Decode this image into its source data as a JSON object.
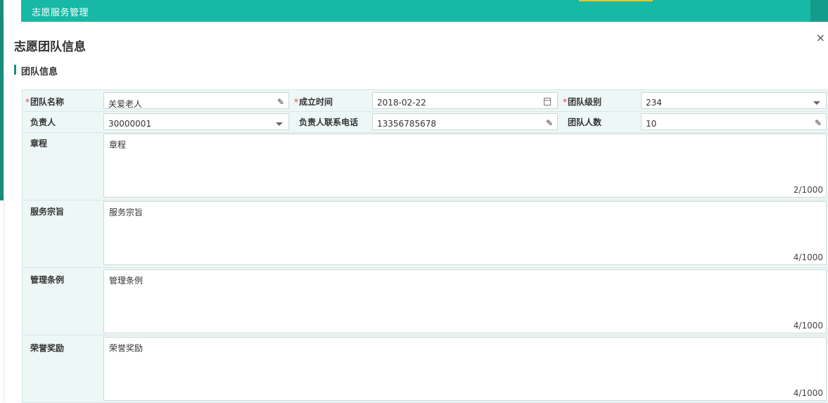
{
  "app": {
    "title": "志愿服务管理",
    "accent_color": "#17b9a6",
    "highlight_color": "#f4c21b"
  },
  "modal": {
    "title": "志愿团队信息",
    "close_icon": "close-icon",
    "section_title": "团队信息"
  },
  "form": {
    "team_name": {
      "label": "团队名称",
      "required": "*",
      "value": "关爱老人",
      "icon": "edit-icon"
    },
    "founded_date": {
      "label": "成立时间",
      "required": "*",
      "value": "2018-02-22",
      "icon": "calendar-icon"
    },
    "team_level": {
      "label": "团队级别",
      "required": "*",
      "value": "234",
      "icon": "dropdown-icon"
    },
    "leader": {
      "label": "负责人",
      "value": "30000001",
      "icon": "dropdown-icon"
    },
    "leader_phone": {
      "label": "负责人联系电话",
      "value": "13356785678",
      "icon": "edit-icon"
    },
    "member_count": {
      "label": "团队人数",
      "value": "10",
      "icon": "edit-icon"
    },
    "charter": {
      "label": "章程",
      "value": "章程",
      "counter": "2/1000"
    },
    "purpose": {
      "label": "服务宗旨",
      "value": "服务宗旨",
      "counter": "4/1000"
    },
    "regulations": {
      "label": "管理条例",
      "value": "管理条例",
      "counter": "4/1000"
    },
    "honors": {
      "label": "荣誉奖励",
      "value": "荣誉奖励",
      "counter": "4/1000"
    }
  }
}
